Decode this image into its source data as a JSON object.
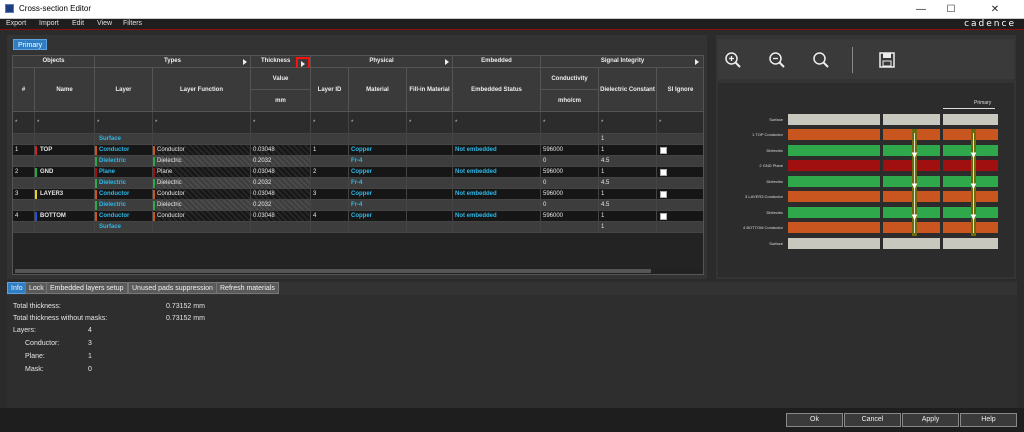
{
  "window": {
    "title": "Cross-section Editor",
    "minimize": "—",
    "maximize": "☐",
    "close": "✕"
  },
  "menu": {
    "items": [
      "Export",
      "Import",
      "Edit",
      "View",
      "Filters"
    ],
    "brand": "cadence"
  },
  "tabs": {
    "primary": "Primary"
  },
  "grid": {
    "groups": {
      "objects": "Objects",
      "types": "Types",
      "thickness": "Thickness",
      "physical": "Physical",
      "embedded": "Embedded",
      "signal": "Signal Integrity"
    },
    "columns": {
      "num": "#",
      "name": "Name",
      "layer": "Layer",
      "layer_function": "Layer Function",
      "value": "Value",
      "value_unit": "mm",
      "layer_id": "Layer ID",
      "material": "Material",
      "fillin": "Fill-in Material",
      "embedded_status": "Embedded Status",
      "conductivity": "Conductivity",
      "conductivity_unit": "mho/cm",
      "dielectric_constant": "Dielectric Constant",
      "si_ignore": "SI Ignore"
    },
    "filter": "*",
    "rows": [
      {
        "num": "",
        "name": "",
        "layer": "Surface",
        "func": "",
        "value": "",
        "id": "",
        "material": "",
        "embedded": "",
        "cond": "",
        "dk": "1",
        "color": "",
        "check": false,
        "style": "light"
      },
      {
        "num": "1",
        "name": "TOP",
        "layer": "Conductor",
        "func": "Conductor",
        "value": "0.03048",
        "id": "1",
        "material": "Copper",
        "embedded": "Not embedded",
        "cond": "596000",
        "dk": "1",
        "color": "#d42020",
        "check": true,
        "style": "dark"
      },
      {
        "num": "",
        "name": "",
        "layer": "Dielectric",
        "func": "Dielectric",
        "value": "0.2032",
        "id": "",
        "material": "Fr-4",
        "embedded": "",
        "cond": "0",
        "dk": "4.5",
        "color": "",
        "check": false,
        "style": "light"
      },
      {
        "num": "2",
        "name": "GND",
        "layer": "Plane",
        "func": "Plane",
        "value": "0.03048",
        "id": "2",
        "material": "Copper",
        "embedded": "Not embedded",
        "cond": "596000",
        "dk": "1",
        "color": "#1fa83c",
        "check": true,
        "style": "dark"
      },
      {
        "num": "",
        "name": "",
        "layer": "Dielectric",
        "func": "Dielectric",
        "value": "0.2032",
        "id": "",
        "material": "Fr-4",
        "embedded": "",
        "cond": "0",
        "dk": "4.5",
        "color": "",
        "check": false,
        "style": "light"
      },
      {
        "num": "3",
        "name": "LAYER3",
        "layer": "Conductor",
        "func": "Conductor",
        "value": "0.03048",
        "id": "3",
        "material": "Copper",
        "embedded": "Not embedded",
        "cond": "596000",
        "dk": "1",
        "color": "#e8d020",
        "check": true,
        "style": "dark"
      },
      {
        "num": "",
        "name": "",
        "layer": "Dielectric",
        "func": "Dielectric",
        "value": "0.2032",
        "id": "",
        "material": "Fr-4",
        "embedded": "",
        "cond": "0",
        "dk": "4.5",
        "color": "",
        "check": false,
        "style": "light"
      },
      {
        "num": "4",
        "name": "BOTTOM",
        "layer": "Conductor",
        "func": "Conductor",
        "value": "0.03048",
        "id": "4",
        "material": "Copper",
        "embedded": "Not embedded",
        "cond": "596000",
        "dk": "1",
        "color": "#2050e0",
        "check": true,
        "style": "dark"
      },
      {
        "num": "",
        "name": "",
        "layer": "Surface",
        "func": "",
        "value": "",
        "id": "",
        "material": "",
        "embedded": "",
        "cond": "",
        "dk": "1",
        "color": "",
        "check": false,
        "style": "light"
      }
    ]
  },
  "stackup": {
    "header": "Primary",
    "labels": [
      "Surface",
      "1   TOP Conductor",
      "Dielectric",
      "2   GND Plane",
      "Dielectric",
      "3   LAYER3 Conductor",
      "Dielectric",
      "4   BOTTOM Conductor",
      "Surface"
    ],
    "layer_colors": [
      "#c8c8be",
      "#c8561e",
      "#2ea84a",
      "#a01010",
      "#2ea84a",
      "#c8561e",
      "#2ea84a",
      "#c8561e",
      "#c8c8be"
    ]
  },
  "bottom_tabs": [
    "Info",
    "Lock",
    "Embedded layers setup",
    "Unused pads suppression",
    "Refresh materials"
  ],
  "info": {
    "total_thickness_label": "Total thickness:",
    "total_thickness": "0.73152 mm",
    "total_no_masks_label": "Total thickness without masks:",
    "total_no_masks": "0.73152 mm",
    "layers_label": "Layers:",
    "layers": "4",
    "conductor_label": "Conductor:",
    "conductor": "3",
    "plane_label": "Plane:",
    "plane": "1",
    "mask_label": "Mask:",
    "mask": "0"
  },
  "footer": {
    "ok": "Ok",
    "cancel": "Cancel",
    "apply": "Apply",
    "help": "Help"
  }
}
